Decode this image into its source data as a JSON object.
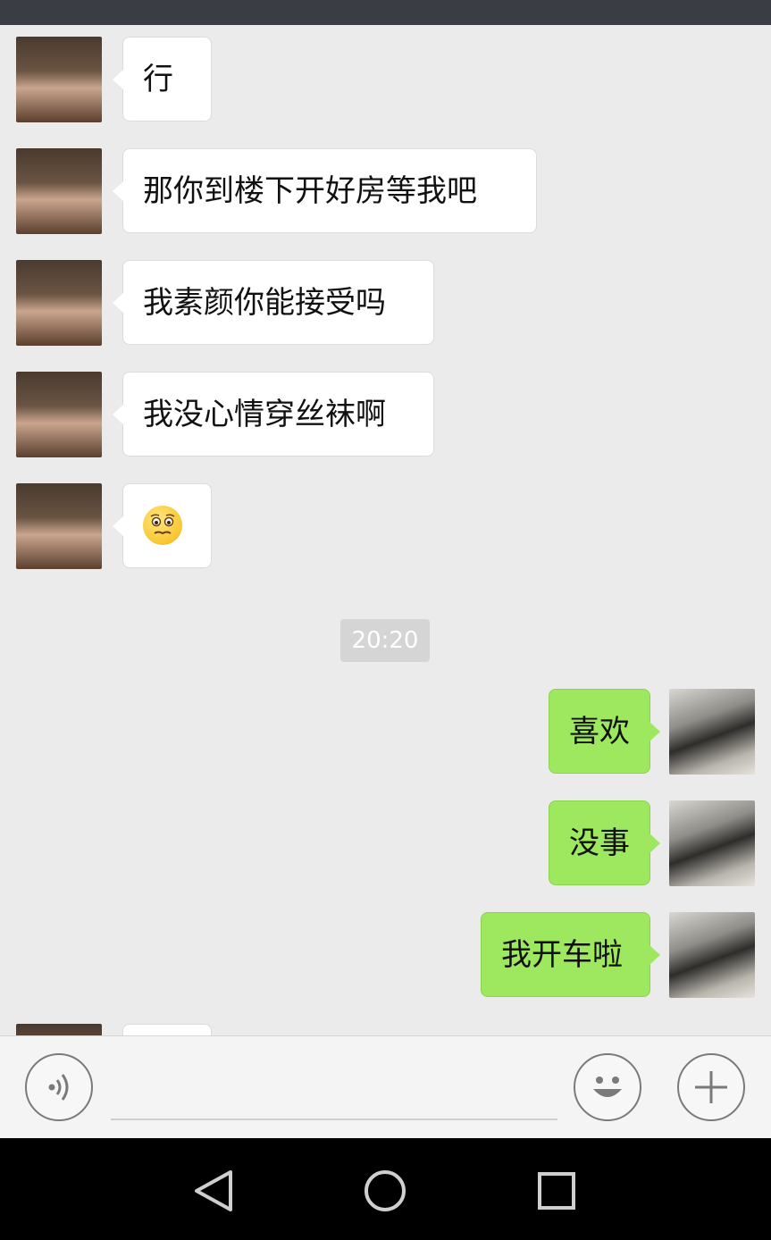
{
  "colors": {
    "chat_background": "#ebebeb",
    "outgoing_bubble": "#9ee85f",
    "incoming_bubble": "#ffffff",
    "status_bar": "#3a3d44",
    "nav_bar": "#000000",
    "timestamp_bg": "#d5d5d5"
  },
  "messages_before_time": [
    {
      "sender": "contact",
      "text": "行"
    },
    {
      "sender": "contact",
      "text": "那你到楼下开好房等我吧"
    },
    {
      "sender": "contact",
      "text": "我素颜你能接受吗"
    },
    {
      "sender": "contact",
      "text": "我没心情穿丝袜啊"
    },
    {
      "sender": "contact",
      "emoji": "worried-face-emoji"
    }
  ],
  "timestamp": "20:20",
  "messages_after_time": [
    {
      "sender": "me",
      "text": "喜欢"
    },
    {
      "sender": "me",
      "text": "没事"
    },
    {
      "sender": "me",
      "text": "我开车啦"
    }
  ],
  "input_bar": {
    "voice_icon": "voice-icon",
    "text_value": "",
    "emoji_icon": "smiley-icon",
    "more_icon": "plus-icon"
  },
  "nav_bar": {
    "back_icon": "back-triangle-icon",
    "home_icon": "home-circle-icon",
    "recents_icon": "recents-square-icon"
  }
}
